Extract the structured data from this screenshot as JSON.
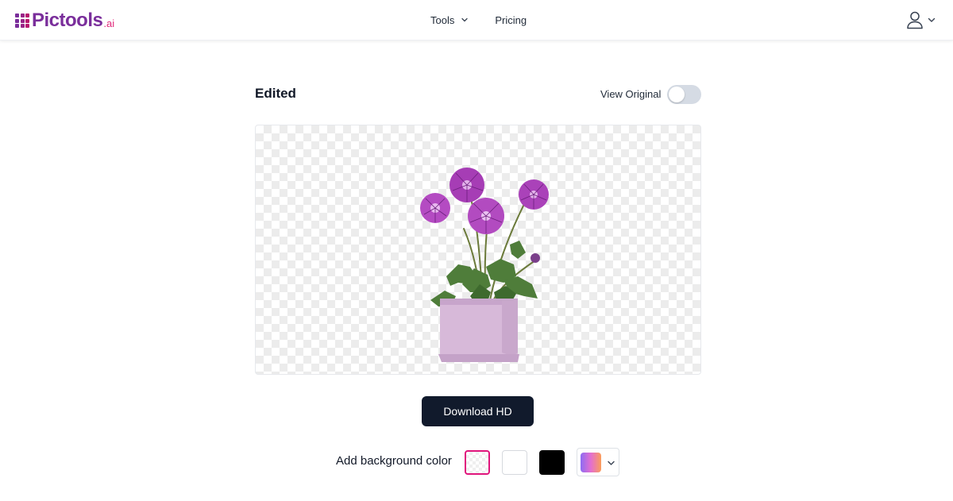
{
  "header": {
    "logo": {
      "text": "Pictools",
      "suffix": ".ai"
    },
    "nav": {
      "tools_label": "Tools",
      "pricing_label": "Pricing"
    },
    "icons": {
      "user": "user-icon",
      "tools_dropdown": "chevron-down-icon",
      "user_dropdown": "chevron-down-icon"
    }
  },
  "main": {
    "title": "Edited",
    "view_original_label": "View Original",
    "view_original_enabled": false,
    "image": {
      "description_icon": "flower-pot-image",
      "background": "transparent-checkerboard"
    },
    "download_label": "Download HD",
    "background_color": {
      "label": "Add background color",
      "options": [
        {
          "name": "transparent",
          "selected": true
        },
        {
          "name": "white",
          "color": "#ffffff",
          "selected": false
        },
        {
          "name": "black",
          "color": "#000000",
          "selected": false
        },
        {
          "name": "gradient",
          "selected": false
        }
      ]
    }
  },
  "colors": {
    "accent": "#e0157c",
    "brand_purple": "#7a2e9b",
    "button_dark": "#111a2c",
    "toggle_off": "#d5dbe4"
  }
}
